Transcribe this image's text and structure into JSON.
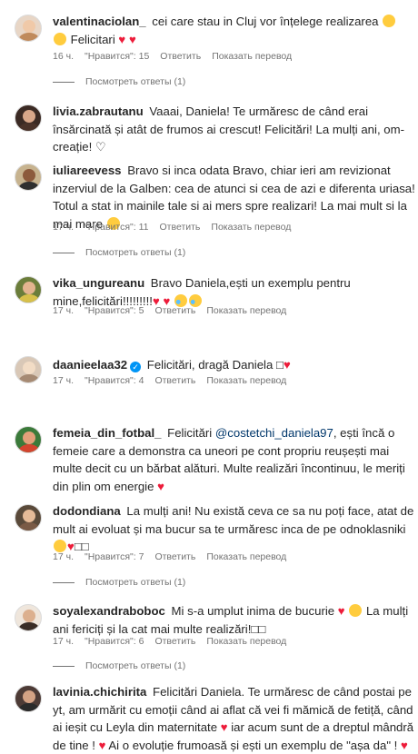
{
  "comments": [
    {
      "user": "valentinaciolan_",
      "text": " cei care stau in Cluj vor înțelege realizarea ",
      "text2": " Felicitari ",
      "time": "16 ч.",
      "likes": "\"Нравится\": 15",
      "reply": "Ответить",
      "translate": "Показать перевод",
      "view_replies": "Посмотреть ответы (1)"
    },
    {
      "user": "livia.zabrautanu",
      "text": " Vaaai, Daniela! Te urmăresc de când erai însărcinată și atât de frumos ai crescut! Felicitări! La mulți ani, om-creație! ",
      "view_replies": ""
    },
    {
      "user": "iuliareevess",
      "text": " Bravo si inca odata Bravo, chiar ieri am revizionat inzerviul de la Galben: cea de atunci si cea de azi e diferenta uriasa! Totul a stat in mainile tale si ai mers spre realizari! La mai mult si la mai mare ",
      "time": "17 ч.",
      "likes": "\"Нравится\": 11",
      "reply": "Ответить",
      "translate": "Показать перевод",
      "view_replies": "Посмотреть ответы (1)"
    },
    {
      "user": "vika_ungureanu",
      "text": " Bravo Daniela,ești un exemplu pentru mine,felicitări!!!!!!!!!",
      "time": "17 ч.",
      "likes": "\"Нравится\": 5",
      "reply": "Ответить",
      "translate": "Показать перевод"
    },
    {
      "user": "daanieelaa32",
      "text": " Felicitări, dragă Daniela ",
      "box": "□",
      "time": "17 ч.",
      "likes": "\"Нравится\": 4",
      "reply": "Ответить",
      "translate": "Показать перевод"
    },
    {
      "user": "femeia_din_fotbal_",
      "text_pre": " Felicitări ",
      "mention": "@costetchi_daniela97",
      "text": ", ești încă o femeie care a demonstra ca uneori pe cont propriu reușești mai multe decit cu un bărbat alături. Multe realizări încontinuu, le meriți din plin om energie "
    },
    {
      "user": "dodondiana",
      "text": " La mulți ani! Nu există ceva ce sa nu poți face, atat de mult ai evoluat și ma bucur sa te urmăresc inca de pe odnoklasniki ",
      "boxes": "□□",
      "time": "17 ч.",
      "likes": "\"Нравится\": 7",
      "reply": "Ответить",
      "translate": "Показать перевод",
      "view_replies": "Посмотреть ответы (1)"
    },
    {
      "user": "soyalexandraboboc",
      "text": " Mi s-a umplut inima de bucurie ",
      "text2": " La mulți ani fericiți și la cat mai multe realizări!",
      "boxes": "□□",
      "time": "17 ч.",
      "likes": "\"Нравится\": 6",
      "reply": "Ответить",
      "translate": "Показать перевод",
      "view_replies": "Посмотреть ответы (1)"
    },
    {
      "user": "lavinia.chichirita",
      "text": " Felicitări Daniela. Te urmăresc de când postai pe yt, am urmărit cu emoții când ai aflat că vei fi mămică de fetiță, când ai ieșit cu Leyla din maternitate ",
      "text2": " iar acum sunt de a dreptul mândră de tine ! ",
      "text3": " Ai o evoluție frumoasă și ești un exemplu de \"așa da\" ! "
    }
  ],
  "colors": {
    "text": "#262626",
    "meta": "#737373",
    "heart": "#ed1c3a",
    "mention": "#00376b",
    "verified": "#0095f6"
  }
}
